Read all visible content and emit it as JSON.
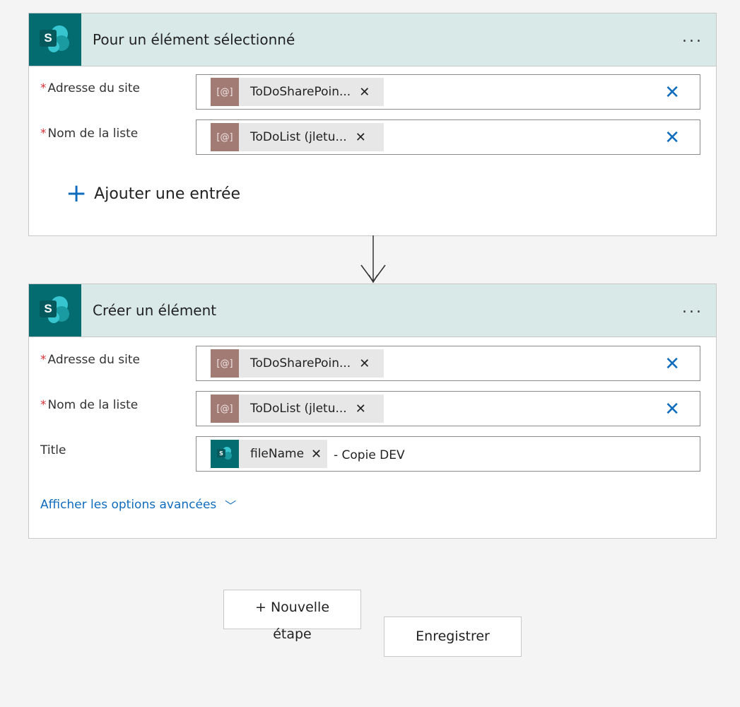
{
  "cards": [
    {
      "title": "Pour un élément sélectionné",
      "more_label": "...",
      "fields": [
        {
          "label": "Adresse du site",
          "required": "*",
          "token_icon": "[@]",
          "token_text": "ToDoSharePoin...",
          "token_remove": "✕",
          "clear": "✕"
        },
        {
          "label": "Nom de la liste",
          "required": "*",
          "token_icon": "[@]",
          "token_text": "ToDoList (jletu...",
          "token_remove": "✕",
          "clear": "✕"
        }
      ],
      "add_entry": {
        "plus": "+",
        "label": "Ajouter une entrée"
      }
    },
    {
      "title": "Créer un élément",
      "more_label": "...",
      "fields": [
        {
          "label": "Adresse du site",
          "required": "*",
          "token_icon": "[@]",
          "token_text": "ToDoSharePoin...",
          "token_remove": "✕",
          "clear": "✕"
        },
        {
          "label": "Nom de la liste",
          "required": "*",
          "token_icon": "[@]",
          "token_text": "ToDoList (jletu...",
          "token_remove": "✕",
          "clear": "✕"
        },
        {
          "label": "Title",
          "token_text": "fileName",
          "token_remove": "✕",
          "suffix": "- Copie DEV"
        }
      ],
      "advanced": {
        "label": "Afficher les options avancées",
        "chevron": "﹀"
      }
    }
  ],
  "logo_letter": "S",
  "buttons": {
    "new_step_line1": "+ Nouvelle",
    "new_step_line2": "étape",
    "save": "Enregistrer"
  },
  "colors": {
    "accent": "#0f6cbd",
    "header_bg": "#d9e9e8",
    "sharepoint": "#036c70",
    "token_icon": "#a27b74",
    "required": "#d13438"
  }
}
